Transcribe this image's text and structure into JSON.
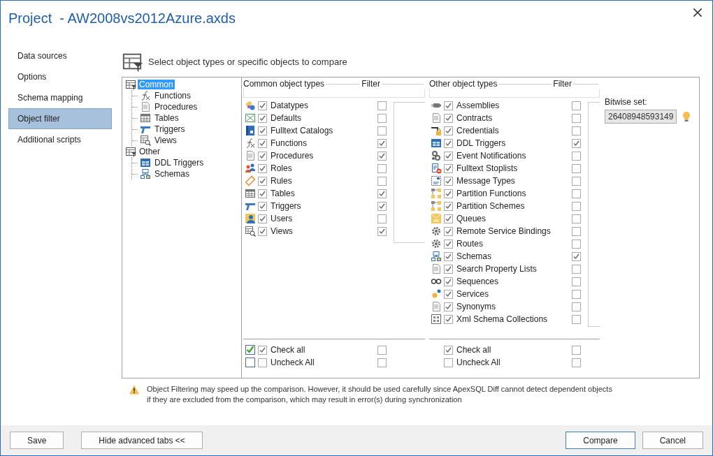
{
  "window": {
    "title": "Project  - AW2008vs2012Azure.axds"
  },
  "sidebar": {
    "items": [
      {
        "label": "Data sources",
        "selected": false
      },
      {
        "label": "Options",
        "selected": false
      },
      {
        "label": "Schema mapping",
        "selected": false
      },
      {
        "label": "Object filter",
        "selected": true
      },
      {
        "label": "Additional scripts",
        "selected": false
      }
    ]
  },
  "header": {
    "text": "Select object types or specific objects to compare"
  },
  "tree": [
    {
      "label": "Common",
      "selected": true,
      "children": [
        {
          "label": "Functions"
        },
        {
          "label": "Procedures"
        },
        {
          "label": "Tables"
        },
        {
          "label": "Triggers"
        },
        {
          "label": "Views"
        }
      ]
    },
    {
      "label": "Other",
      "selected": false,
      "children": [
        {
          "label": "DDL Triggers"
        },
        {
          "label": "Schemas"
        }
      ]
    }
  ],
  "common": {
    "heading": "Common object types",
    "filter_heading": "Filter",
    "items": [
      {
        "label": "Datatypes",
        "checked": true,
        "filter": false
      },
      {
        "label": "Defaults",
        "checked": true,
        "filter": false
      },
      {
        "label": "Fulltext Catalogs",
        "checked": true,
        "filter": false
      },
      {
        "label": "Functions",
        "checked": true,
        "filter": true
      },
      {
        "label": "Procedures",
        "checked": true,
        "filter": true
      },
      {
        "label": "Roles",
        "checked": true,
        "filter": false
      },
      {
        "label": "Rules",
        "checked": true,
        "filter": false
      },
      {
        "label": "Tables",
        "checked": true,
        "filter": true
      },
      {
        "label": "Triggers",
        "checked": true,
        "filter": true
      },
      {
        "label": "Users",
        "checked": true,
        "filter": false
      },
      {
        "label": "Views",
        "checked": true,
        "filter": true
      }
    ],
    "check_all": {
      "label": "Check all",
      "checked": true,
      "filter": false
    },
    "uncheck_all": {
      "label": "Uncheck All",
      "checked": false,
      "filter": false
    }
  },
  "other": {
    "heading": "Other object types",
    "filter_heading": "Filter",
    "items": [
      {
        "label": "Assemblies",
        "checked": true,
        "filter": false
      },
      {
        "label": "Contracts",
        "checked": true,
        "filter": false
      },
      {
        "label": "Credentials",
        "checked": true,
        "filter": false
      },
      {
        "label": "DDL Triggers",
        "checked": true,
        "filter": true
      },
      {
        "label": "Event Notifications",
        "checked": true,
        "filter": false
      },
      {
        "label": "Fulltext Stoplists",
        "checked": true,
        "filter": false
      },
      {
        "label": "Message Types",
        "checked": true,
        "filter": false
      },
      {
        "label": "Partition Functions",
        "checked": true,
        "filter": false
      },
      {
        "label": "Partition Schemes",
        "checked": true,
        "filter": false
      },
      {
        "label": "Queues",
        "checked": true,
        "filter": false
      },
      {
        "label": "Remote Service Bindings",
        "checked": true,
        "filter": false
      },
      {
        "label": "Routes",
        "checked": true,
        "filter": false
      },
      {
        "label": "Schemas",
        "checked": true,
        "filter": true
      },
      {
        "label": "Search Property Lists",
        "checked": true,
        "filter": false
      },
      {
        "label": "Sequences",
        "checked": true,
        "filter": false
      },
      {
        "label": "Services",
        "checked": true,
        "filter": false
      },
      {
        "label": "Synonyms",
        "checked": true,
        "filter": false
      },
      {
        "label": "Xml Schema Collections",
        "checked": true,
        "filter": false
      }
    ],
    "check_all": {
      "label": "Check all",
      "checked": true,
      "filter": false
    },
    "uncheck_all": {
      "label": "Uncheck All",
      "checked": false,
      "filter": false
    }
  },
  "bitwise": {
    "label": "Bitwise set:",
    "value": "26408948593149"
  },
  "notice": {
    "text": "Object Filtering may speed up the comparison. However, it should be used carefully since ApexSQL Diff cannot detect dependent objects\nif they are excluded from the comparison, which may result in error(s) during synchronization"
  },
  "buttons": {
    "left": [
      {
        "label": "Save",
        "default": false
      },
      {
        "label": "Hide advanced tabs <<",
        "default": false
      }
    ],
    "right": [
      {
        "label": "Compare",
        "default": true
      },
      {
        "label": "Cancel",
        "default": false
      }
    ]
  }
}
